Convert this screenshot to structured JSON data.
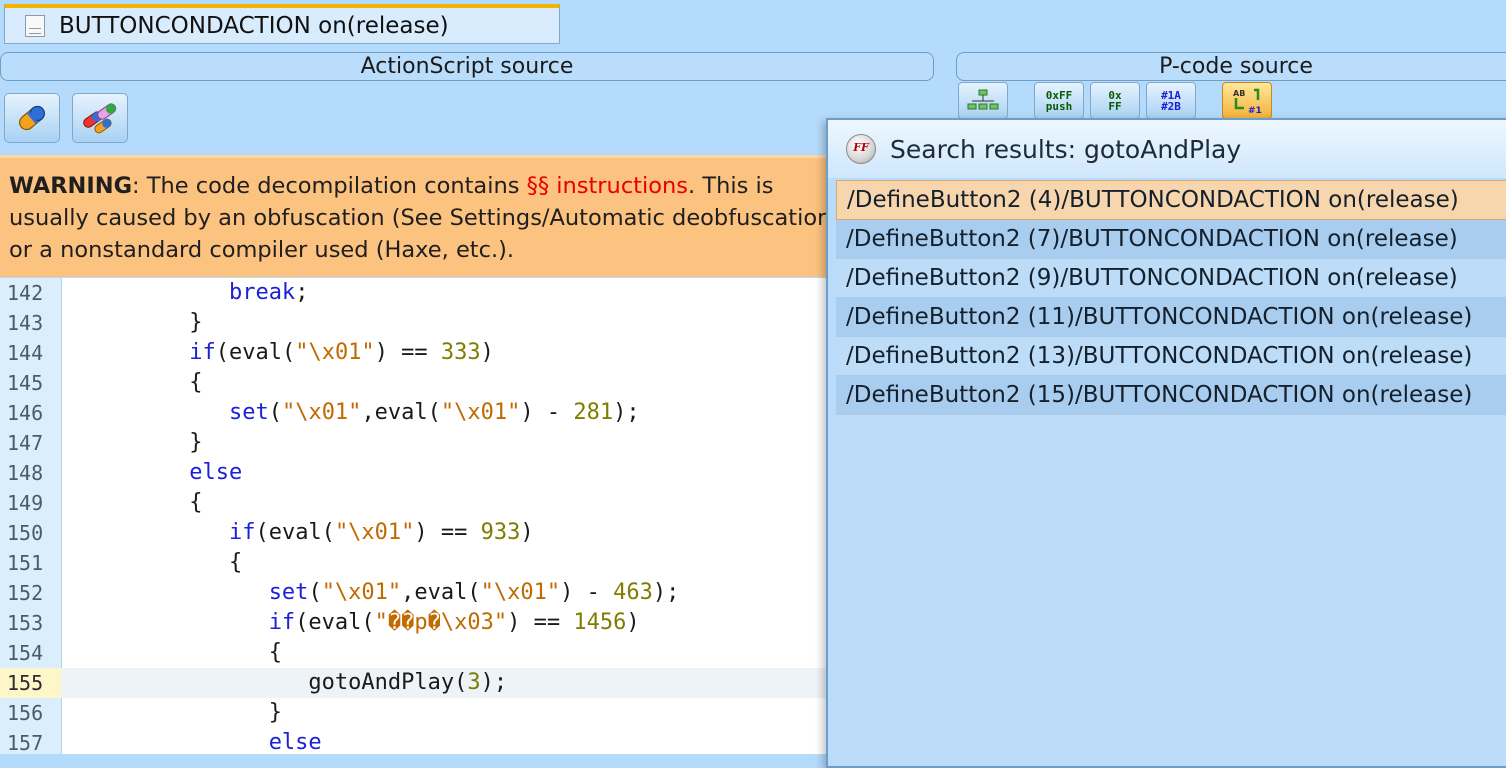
{
  "tab": {
    "title": "BUTTONCONDACTION on(release)"
  },
  "actionscript_header": "ActionScript source",
  "pcode_header": "P-code source",
  "pcode_toolbar": [
    {
      "label": "",
      "icon": "graph-icon"
    },
    {
      "label": "0xFF push",
      "icon": "push-icon"
    },
    {
      "label": "0x FF",
      "icon": "hex-icon"
    },
    {
      "label": "#1A #2B",
      "icon": "constants-icon"
    },
    {
      "label": "",
      "icon": "resolve-constants-icon"
    }
  ],
  "warning": {
    "label": "WARNING",
    "text1": ": The code decompilation contains ",
    "highlight": "§§ instructions",
    "text2": ". This is usually caused by an obfuscation (See Settings/Automatic deobfuscation) or a nonstandard compiler used (Haxe, etc.)."
  },
  "code_lines": [
    {
      "ln": "142",
      "parts": [
        [
          "ind",
          "            "
        ],
        [
          "kw",
          "break"
        ],
        [
          "p",
          ";"
        ]
      ]
    },
    {
      "ln": "143",
      "parts": [
        [
          "ind",
          "         "
        ],
        [
          "p",
          "}"
        ]
      ]
    },
    {
      "ln": "144",
      "parts": [
        [
          "ind",
          "         "
        ],
        [
          "kw",
          "if"
        ],
        [
          "p",
          "(eval("
        ],
        [
          "str",
          "\"\\x01\""
        ],
        [
          "p",
          ") == "
        ],
        [
          "num",
          "333"
        ],
        [
          "p",
          ")"
        ]
      ]
    },
    {
      "ln": "145",
      "parts": [
        [
          "ind",
          "         "
        ],
        [
          "p",
          "{"
        ]
      ]
    },
    {
      "ln": "146",
      "parts": [
        [
          "ind",
          "            "
        ],
        [
          "kw",
          "set"
        ],
        [
          "p",
          "("
        ],
        [
          "str",
          "\"\\x01\""
        ],
        [
          "p",
          ",eval("
        ],
        [
          "str",
          "\"\\x01\""
        ],
        [
          "p",
          ") - "
        ],
        [
          "num",
          "281"
        ],
        [
          "p",
          ");"
        ]
      ]
    },
    {
      "ln": "147",
      "parts": [
        [
          "ind",
          "         "
        ],
        [
          "p",
          "}"
        ]
      ]
    },
    {
      "ln": "148",
      "parts": [
        [
          "ind",
          "         "
        ],
        [
          "kw",
          "else"
        ]
      ]
    },
    {
      "ln": "149",
      "parts": [
        [
          "ind",
          "         "
        ],
        [
          "p",
          "{"
        ]
      ]
    },
    {
      "ln": "150",
      "parts": [
        [
          "ind",
          "            "
        ],
        [
          "kw",
          "if"
        ],
        [
          "p",
          "(eval("
        ],
        [
          "str",
          "\"\\x01\""
        ],
        [
          "p",
          ") == "
        ],
        [
          "num",
          "933"
        ],
        [
          "p",
          ")"
        ]
      ]
    },
    {
      "ln": "151",
      "parts": [
        [
          "ind",
          "            "
        ],
        [
          "p",
          "{"
        ]
      ]
    },
    {
      "ln": "152",
      "parts": [
        [
          "ind",
          "               "
        ],
        [
          "kw",
          "set"
        ],
        [
          "p",
          "("
        ],
        [
          "str",
          "\"\\x01\""
        ],
        [
          "p",
          ",eval("
        ],
        [
          "str",
          "\"\\x01\""
        ],
        [
          "p",
          ") - "
        ],
        [
          "num",
          "463"
        ],
        [
          "p",
          ");"
        ]
      ]
    },
    {
      "ln": "153",
      "parts": [
        [
          "ind",
          "               "
        ],
        [
          "kw",
          "if"
        ],
        [
          "p",
          "(eval("
        ],
        [
          "str",
          "\"��p�\\x03\""
        ],
        [
          "p",
          ") == "
        ],
        [
          "num",
          "1456"
        ],
        [
          "p",
          ")"
        ]
      ]
    },
    {
      "ln": "154",
      "parts": [
        [
          "ind",
          "               "
        ],
        [
          "p",
          "{"
        ]
      ]
    },
    {
      "ln": "155",
      "current": true,
      "parts": [
        [
          "ind",
          "                  "
        ],
        [
          "p",
          "gotoAndPlay("
        ],
        [
          "num",
          "3"
        ],
        [
          "p",
          ");"
        ]
      ]
    },
    {
      "ln": "156",
      "parts": [
        [
          "ind",
          "               "
        ],
        [
          "p",
          "}"
        ]
      ]
    },
    {
      "ln": "157",
      "parts": [
        [
          "ind",
          "               "
        ],
        [
          "kw",
          "else"
        ]
      ]
    }
  ],
  "search": {
    "title": "Search results: gotoAndPlay",
    "icon_label": "FF",
    "results": [
      "/DefineButton2 (4)/BUTTONCONDACTION on(release)",
      "/DefineButton2 (7)/BUTTONCONDACTION on(release)",
      "/DefineButton2 (9)/BUTTONCONDACTION on(release)",
      "/DefineButton2 (11)/BUTTONCONDACTION on(release)",
      "/DefineButton2 (13)/BUTTONCONDACTION on(release)",
      "/DefineButton2 (15)/BUTTONCONDACTION on(release)"
    ],
    "selected_index": 0
  },
  "colors": {
    "keyword": "#1b21d6",
    "string": "#c06a00",
    "number": "#7f7d00",
    "warning_bg": "#fcc27f",
    "highlight_red": "#e80000"
  }
}
